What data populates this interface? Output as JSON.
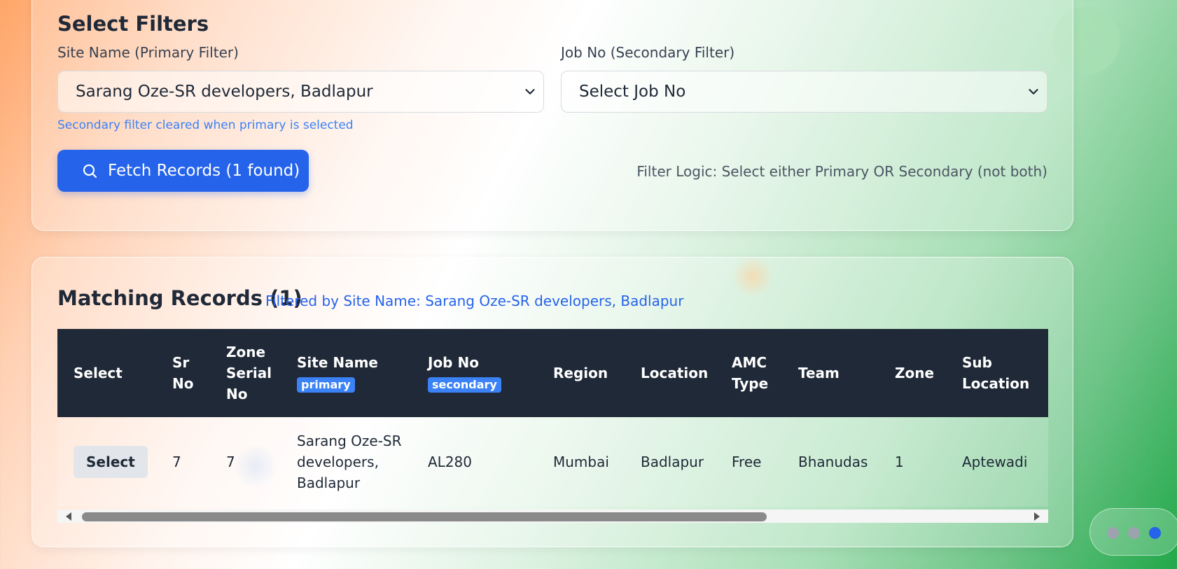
{
  "filters": {
    "title": "Select Filters",
    "primary": {
      "label": "Site Name (Primary Filter)",
      "value": "Sarang Oze-SR developers, Badlapur"
    },
    "secondary": {
      "label": "Job No (Secondary Filter)",
      "value": "Select Job No"
    },
    "hint": "Secondary filter cleared when primary is selected",
    "fetch_button": "Fetch Records (1 found)",
    "logic_text": "Filter Logic: Select either Primary OR Secondary (not both)"
  },
  "records": {
    "title": "Matching Records (1)",
    "subtitle": "Filtered by Site Name: Sarang Oze-SR developers, Badlapur",
    "columns": {
      "select": "Select",
      "sr_no": "Sr No",
      "zone_serial_no": "Zone Serial No",
      "site_name": "Site Name",
      "site_name_tag": "primary",
      "job_no": "Job No",
      "job_no_tag": "secondary",
      "region": "Region",
      "location": "Location",
      "amc_type": "AMC Type",
      "team": "Team",
      "zone": "Zone",
      "sub_location": "Sub Location"
    },
    "rows": [
      {
        "select_label": "Select",
        "sr_no": "7",
        "zone_serial_no": "7",
        "site_name": "Sarang Oze-SR developers, Badlapur",
        "job_no": "AL280",
        "region": "Mumbai",
        "location": "Badlapur",
        "amc_type": "Free",
        "team": "Bhanudas",
        "zone": "1",
        "sub_location": "Aptewadi"
      }
    ]
  },
  "icons": {
    "fetch": "search-icon",
    "dropdown": "chevron-down-icon",
    "scroll_left": "scroll-left-arrow-icon",
    "scroll_right": "scroll-right-arrow-icon"
  },
  "colors": {
    "accent": "#2563eb",
    "table_header": "#1f2937",
    "tag": "#3b82f6"
  },
  "pager": {
    "active_index": 3,
    "count": 3
  }
}
